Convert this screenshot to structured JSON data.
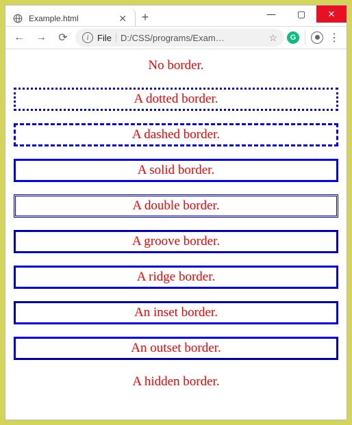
{
  "window": {
    "minimize": "—",
    "maximize": "▢",
    "close": "✕"
  },
  "tab": {
    "title": "Example.html",
    "close": "✕",
    "newtab": "+"
  },
  "toolbar": {
    "back": "←",
    "forward": "→",
    "reload": "⟳",
    "info": "i",
    "file_label": "File",
    "url": "D:/CSS/programs/Exam…",
    "star": "☆",
    "ext": "G",
    "menu": "⋮"
  },
  "examples": {
    "none": "No border.",
    "dotted": "A dotted border.",
    "dashed": "A dashed border.",
    "solid": "A solid border.",
    "double": "A double border.",
    "groove": "A groove border.",
    "ridge": "A ridge border.",
    "inset": "An inset border.",
    "outset": "An outset border.",
    "hidden": "A hidden border."
  }
}
